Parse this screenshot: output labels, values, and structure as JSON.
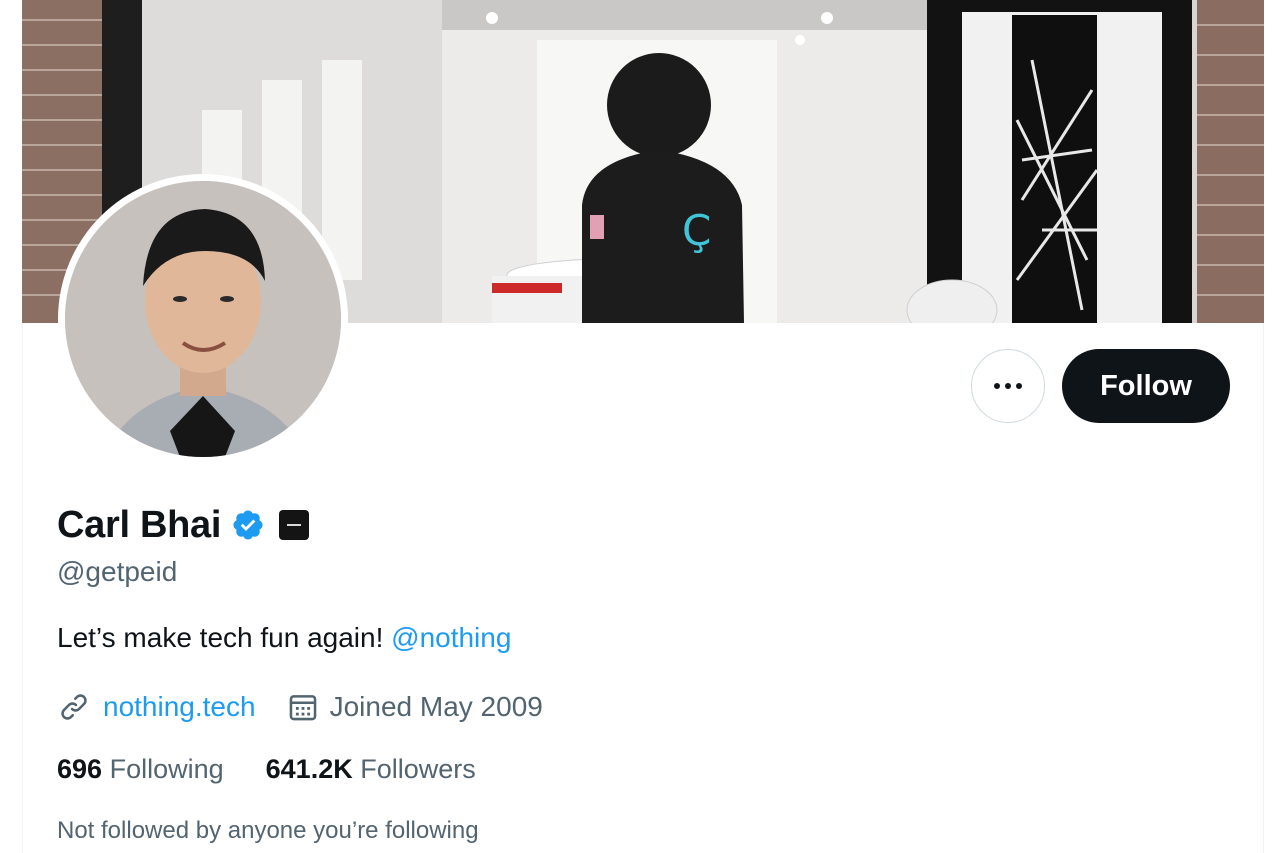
{
  "profile": {
    "display_name": "Carl Bhai",
    "handle": "@getpeid",
    "bio_text": "Let’s make tech fun again! ",
    "bio_mention": "@nothing",
    "website": "nothing.tech",
    "joined": "Joined May 2009",
    "following_count": "696",
    "following_label": "Following",
    "followers_count": "641.2K",
    "followers_label": "Followers",
    "not_followed_note": "Not followed by anyone you’re following"
  },
  "actions": {
    "follow_label": "Follow"
  },
  "icons": {
    "more": "more-horizontal-icon",
    "verified": "verified-badge-icon",
    "affiliate": "affiliate-badge-icon",
    "link": "link-icon",
    "calendar": "calendar-icon"
  },
  "colors": {
    "accent": "#1d9bf0",
    "primary_text": "#0f1419",
    "secondary_text": "#536471",
    "follow_button": "#0f1419"
  }
}
